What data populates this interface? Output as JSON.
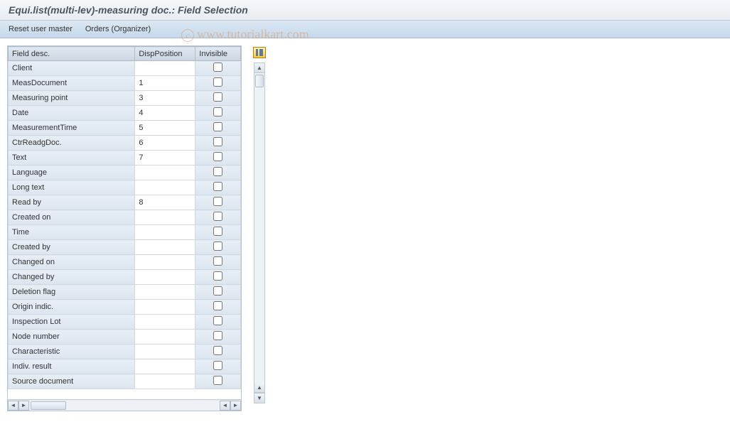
{
  "title": "Equi.list(multi-lev)-measuring doc.: Field Selection",
  "toolbar": {
    "reset": "Reset user master",
    "orders": "Orders (Organizer)"
  },
  "watermark": "www.tutorialkart.com",
  "table": {
    "headers": {
      "desc": "Field desc.",
      "pos": "DispPosition",
      "inv": "Invisible"
    },
    "rows": [
      {
        "desc": "Client",
        "pos": "",
        "inv": false
      },
      {
        "desc": "MeasDocument",
        "pos": "1",
        "inv": false
      },
      {
        "desc": "Measuring point",
        "pos": "3",
        "inv": false
      },
      {
        "desc": "Date",
        "pos": "4",
        "inv": false
      },
      {
        "desc": "MeasurementTime",
        "pos": "5",
        "inv": false
      },
      {
        "desc": "CtrReadgDoc.",
        "pos": "6",
        "inv": false
      },
      {
        "desc": "Text",
        "pos": "7",
        "inv": false
      },
      {
        "desc": "Language",
        "pos": "",
        "inv": false
      },
      {
        "desc": "Long text",
        "pos": "",
        "inv": false
      },
      {
        "desc": "Read by",
        "pos": "8",
        "inv": false
      },
      {
        "desc": "Created on",
        "pos": "",
        "inv": false
      },
      {
        "desc": "Time",
        "pos": "",
        "inv": false
      },
      {
        "desc": "Created by",
        "pos": "",
        "inv": false
      },
      {
        "desc": "Changed on",
        "pos": "",
        "inv": false
      },
      {
        "desc": "Changed by",
        "pos": "",
        "inv": false
      },
      {
        "desc": "Deletion flag",
        "pos": "",
        "inv": false
      },
      {
        "desc": "Origin indic.",
        "pos": "",
        "inv": false
      },
      {
        "desc": "Inspection Lot",
        "pos": "",
        "inv": false
      },
      {
        "desc": "Node number",
        "pos": "",
        "inv": false
      },
      {
        "desc": "Characteristic",
        "pos": "",
        "inv": false
      },
      {
        "desc": "Indiv. result",
        "pos": "",
        "inv": false
      },
      {
        "desc": "Source document",
        "pos": "",
        "inv": false
      }
    ]
  }
}
